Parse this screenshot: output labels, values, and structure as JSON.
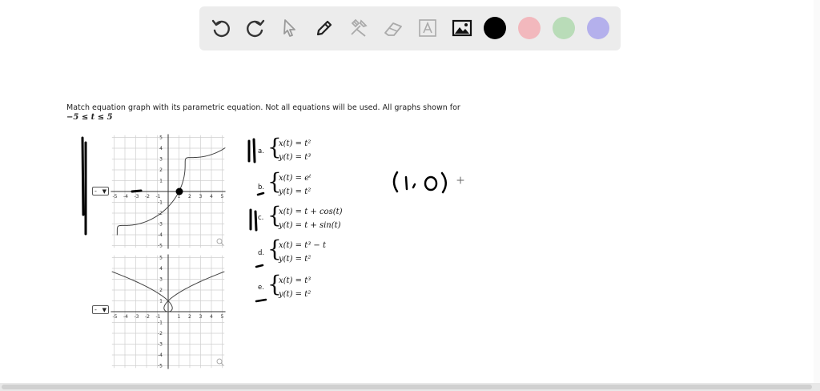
{
  "toolbar": {
    "tools": [
      {
        "icon": "undo-icon"
      },
      {
        "icon": "redo-icon"
      },
      {
        "icon": "pointer-icon"
      },
      {
        "icon": "pen-icon"
      },
      {
        "icon": "tools-icon"
      },
      {
        "icon": "eraser-icon"
      },
      {
        "icon": "text-icon"
      },
      {
        "icon": "image-icon"
      }
    ],
    "colors": [
      "#000000",
      "#f2b8bd",
      "#b9dcb8",
      "#b4b0ec"
    ]
  },
  "problem": {
    "text": "Match equation graph with its parametric equation. Not all equations will be used. All graphs shown for",
    "range": "−5 ≤ t ≤ 5"
  },
  "graphs": [
    {
      "select_value": "-",
      "curve": "x = t + cos(t), y = t + sin(t)"
    },
    {
      "select_value": "-",
      "curve": "x = t^3 − t, y = t^2"
    }
  ],
  "axis_ticks": {
    "x": [
      "-5",
      "-4",
      "-3",
      "-2",
      "-1",
      "1",
      "2",
      "3",
      "4",
      "5"
    ],
    "y": [
      "5",
      "4",
      "3",
      "2",
      "1",
      "-1",
      "-2",
      "-3",
      "-4",
      "-5"
    ]
  },
  "equations": [
    {
      "letter": "a.",
      "x": "x(t) = t²",
      "y": "y(t) = t³"
    },
    {
      "letter": "b.",
      "x": "x(t) = eᵗ",
      "y": "y(t) = t²"
    },
    {
      "letter": "c.",
      "x": "x(t) = t + cos(t)",
      "y": "y(t) = t + sin(t)"
    },
    {
      "letter": "d.",
      "x": "x(t) = t³ − t",
      "y": "y(t) = t²"
    },
    {
      "letter": "e.",
      "x": "x(t) = t³",
      "y": "y(t) = t²"
    }
  ],
  "handwriting": {
    "point": "(1,0)"
  }
}
